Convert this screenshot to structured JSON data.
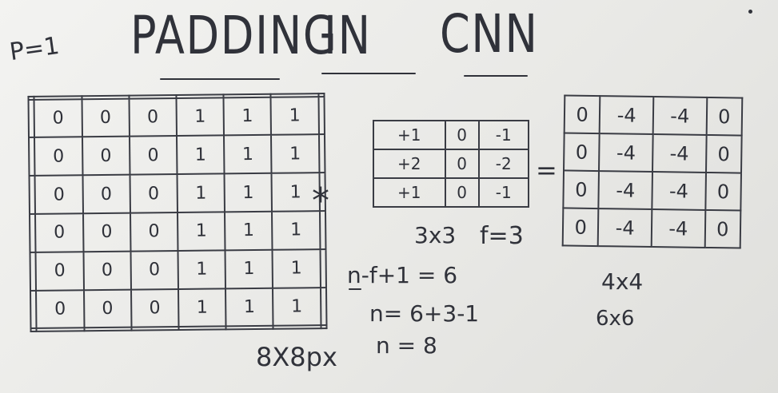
{
  "note_topleft": "P=1",
  "title": {
    "w1": "PADDING",
    "w2": "IN",
    "w3": "CNN"
  },
  "input_matrix": {
    "rows": [
      [
        "",
        "",
        "",
        "",
        "",
        "",
        "",
        ""
      ],
      [
        "",
        "0",
        "0",
        "0",
        "1",
        "1",
        "1",
        ""
      ],
      [
        "",
        "0",
        "0",
        "0",
        "1",
        "1",
        "1",
        ""
      ],
      [
        "",
        "0",
        "0",
        "0",
        "1",
        "1",
        "1",
        ""
      ],
      [
        "",
        "0",
        "0",
        "0",
        "1",
        "1",
        "1",
        ""
      ],
      [
        "",
        "0",
        "0",
        "0",
        "1",
        "1",
        "1",
        ""
      ],
      [
        "",
        "0",
        "0",
        "0",
        "1",
        "1",
        "1",
        ""
      ],
      [
        "",
        "",
        "",
        "",
        "",
        "",
        "",
        ""
      ]
    ],
    "size_label": "8X8px"
  },
  "operator": "*",
  "kernel": {
    "rows": [
      [
        "+1",
        "0",
        "-1"
      ],
      [
        "+2",
        "0",
        "-2"
      ],
      [
        "+1",
        "0",
        "-1"
      ]
    ],
    "size_label": "3x3",
    "f_label": "f=3"
  },
  "equals": "=",
  "output_matrix": {
    "rows": [
      [
        "0",
        "-4",
        "-4",
        "0"
      ],
      [
        "0",
        "-4",
        "-4",
        "0"
      ],
      [
        "0",
        "-4",
        "-4",
        "0"
      ],
      [
        "0",
        "-4",
        "-4",
        "0"
      ]
    ],
    "size_label": "4x4",
    "alt_size_label": "6x6"
  },
  "equations": [
    "n-f+1 = 6",
    "n= 6+3-1",
    "n = 8"
  ]
}
